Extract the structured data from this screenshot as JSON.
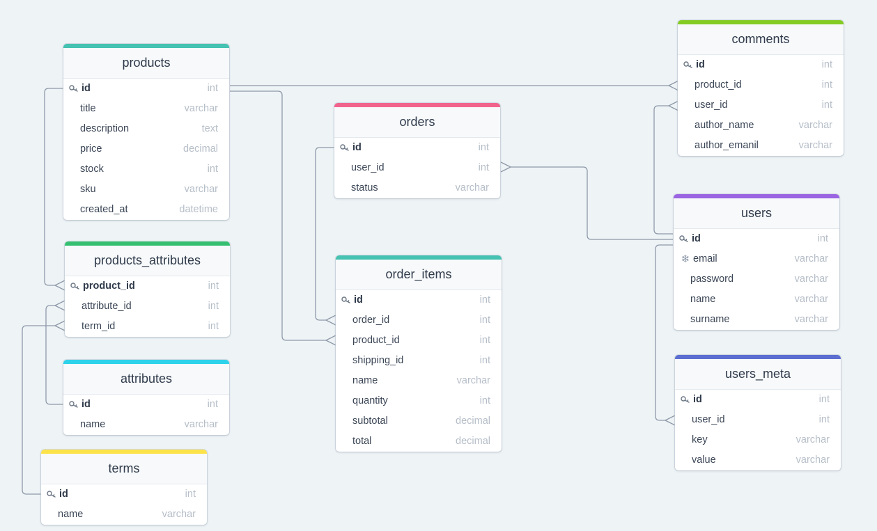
{
  "tables": {
    "products": {
      "name": "products",
      "color": "#45c2b1",
      "fields": [
        {
          "name": "id",
          "type": "int",
          "pk": true
        },
        {
          "name": "title",
          "type": "varchar"
        },
        {
          "name": "description",
          "type": "text"
        },
        {
          "name": "price",
          "type": "decimal"
        },
        {
          "name": "stock",
          "type": "int"
        },
        {
          "name": "sku",
          "type": "varchar"
        },
        {
          "name": "created_at",
          "type": "datetime"
        }
      ]
    },
    "products_attributes": {
      "name": "products_attributes",
      "color": "#34c070",
      "fields": [
        {
          "name": "product_id",
          "type": "int",
          "pk": true
        },
        {
          "name": "attribute_id",
          "type": "int"
        },
        {
          "name": "term_id",
          "type": "int"
        }
      ]
    },
    "attributes": {
      "name": "attributes",
      "color": "#2ed2ea",
      "fields": [
        {
          "name": "id",
          "type": "int",
          "pk": true
        },
        {
          "name": "name",
          "type": "varchar"
        }
      ]
    },
    "terms": {
      "name": "terms",
      "color": "#fde34a",
      "fields": [
        {
          "name": "id",
          "type": "int",
          "pk": true
        },
        {
          "name": "name",
          "type": "varchar"
        }
      ]
    },
    "orders": {
      "name": "orders",
      "color": "#f0648c",
      "fields": [
        {
          "name": "id",
          "type": "int",
          "pk": true
        },
        {
          "name": "user_id",
          "type": "int"
        },
        {
          "name": "status",
          "type": "varchar"
        }
      ]
    },
    "order_items": {
      "name": "order_items",
      "color": "#45c2b1",
      "fields": [
        {
          "name": "id",
          "type": "int",
          "pk": true
        },
        {
          "name": "order_id",
          "type": "int"
        },
        {
          "name": "product_id",
          "type": "int"
        },
        {
          "name": "shipping_id",
          "type": "int"
        },
        {
          "name": "name",
          "type": "varchar"
        },
        {
          "name": "quantity",
          "type": "int"
        },
        {
          "name": "subtotal",
          "type": "decimal"
        },
        {
          "name": "total",
          "type": "decimal"
        }
      ]
    },
    "comments": {
      "name": "comments",
      "color": "#84cc24",
      "fields": [
        {
          "name": "id",
          "type": "int",
          "pk": true
        },
        {
          "name": "product_id",
          "type": "int"
        },
        {
          "name": "user_id",
          "type": "int"
        },
        {
          "name": "author_name",
          "type": "varchar"
        },
        {
          "name": "author_emanil",
          "type": "varchar"
        }
      ]
    },
    "users": {
      "name": "users",
      "color": "#9a64e2",
      "fields": [
        {
          "name": "id",
          "type": "int",
          "pk": true
        },
        {
          "name": "email",
          "type": "varchar",
          "unique": true
        },
        {
          "name": "password",
          "type": "varchar"
        },
        {
          "name": "name",
          "type": "varchar"
        },
        {
          "name": "surname",
          "type": "varchar"
        }
      ]
    },
    "users_meta": {
      "name": "users_meta",
      "color": "#5c6ed0",
      "fields": [
        {
          "name": "id",
          "type": "int",
          "pk": true
        },
        {
          "name": "user_id",
          "type": "int"
        },
        {
          "name": "key",
          "type": "varchar"
        },
        {
          "name": "value",
          "type": "varchar"
        }
      ]
    }
  },
  "relations": [
    {
      "from": "products.id",
      "to": "comments.product_id"
    },
    {
      "from": "products.id",
      "to": "order_items.product_id"
    },
    {
      "from": "products.id",
      "to": "products_attributes.product_id"
    },
    {
      "from": "orders.id",
      "to": "order_items.order_id"
    },
    {
      "from": "users.id",
      "to": "orders.user_id"
    },
    {
      "from": "users.id",
      "to": "comments.user_id"
    },
    {
      "from": "users.id",
      "to": "users_meta.user_id"
    },
    {
      "from": "attributes.id",
      "to": "products_attributes.attribute_id"
    },
    {
      "from": "terms.id",
      "to": "products_attributes.term_id"
    }
  ],
  "colors": {
    "line": "#8e99a8",
    "background": "#eef3f6"
  }
}
